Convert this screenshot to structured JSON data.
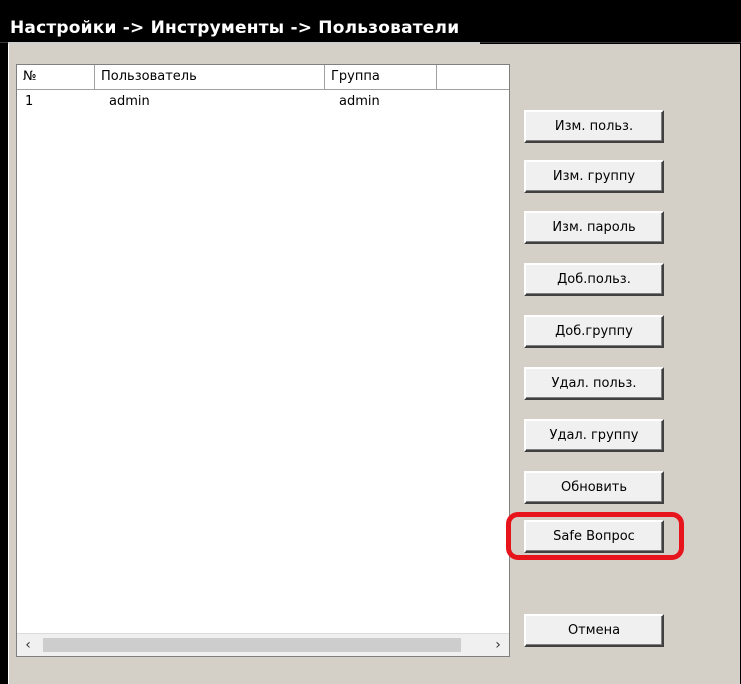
{
  "header": {
    "title": "Настройки -> Инструменты -> Пользователи"
  },
  "table": {
    "columns": [
      "№",
      "Пользователь",
      "Группа"
    ],
    "rows": [
      [
        "1",
        "admin",
        "admin"
      ]
    ]
  },
  "buttons": {
    "edit_user": "Изм. польз.",
    "edit_group": "Изм. группу",
    "edit_password": "Изм. пароль",
    "add_user": "Доб.польз.",
    "add_group": "Доб.группу",
    "delete_user": "Удал. польз.",
    "delete_group": "Удал. группу",
    "refresh": "Обновить",
    "safe_question": "Safe Вопрос",
    "cancel": "Отмена"
  },
  "scrollbar": {
    "left_arrow": "‹",
    "right_arrow": "›"
  },
  "colors": {
    "highlight": "#e8141c",
    "panel": "#d4d0c8"
  }
}
